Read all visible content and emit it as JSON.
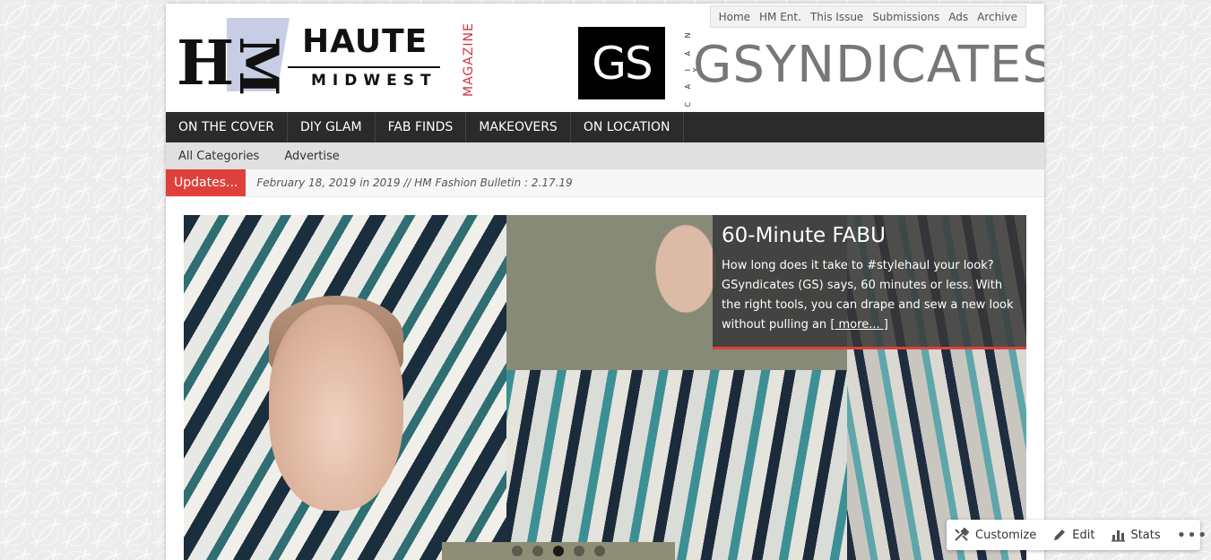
{
  "top_nav": [
    "Home",
    "HM Ent.",
    "This Issue",
    "Submissions",
    "Ads",
    "Archive"
  ],
  "logo": {
    "hm": "HM",
    "haute": "HAUTE",
    "midwest": "MIDWEST",
    "magazine": "MAGAZINE"
  },
  "banner": {
    "gs": "GS",
    "tagline": "C A I A N Y",
    "name": "GSYNDICATES"
  },
  "main_nav": [
    "ON THE COVER",
    "DIY GLAM",
    "FAB FINDS",
    "MAKEOVERS",
    "ON LOCATION"
  ],
  "sub_nav": [
    "All Categories",
    "Advertise"
  ],
  "ticker": {
    "label": "Updates...",
    "text": "February 18, 2019 in 2019 // HM Fashion Bulletin : 2.17.19"
  },
  "slider": {
    "title": "60-Minute FABU",
    "body": "How long does it take to #stylehaul your look? GSyndicates (GS) says, 60 minutes or less. With the right tools, you can drape and sew a new look without pulling an",
    "more": "[ more... ]",
    "dots": 5,
    "active_dot": 3
  },
  "admin_bar": {
    "customize": "Customize",
    "edit": "Edit",
    "stats": "Stats",
    "more": "•••"
  },
  "colors": {
    "accent": "#e0403b",
    "nav_bg": "#2b2b2b",
    "magazine_red": "#d0343d"
  }
}
